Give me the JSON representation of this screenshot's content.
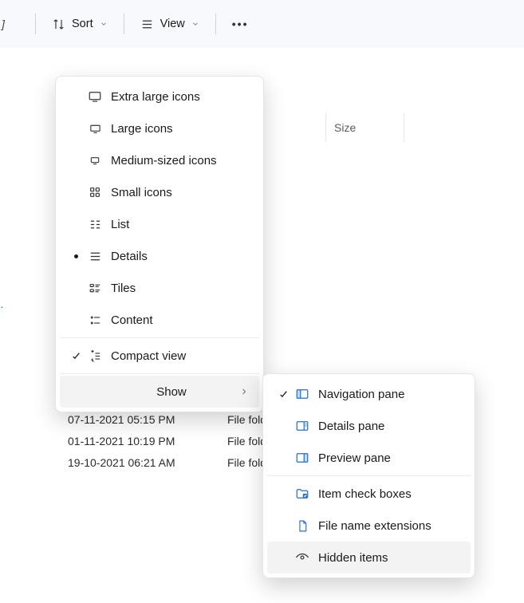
{
  "toolbar": {
    "sort_label": "Sort",
    "view_label": "View"
  },
  "columns": {
    "size": "Size"
  },
  "view_menu": {
    "items": [
      {
        "label": "Extra large icons"
      },
      {
        "label": "Large icons"
      },
      {
        "label": "Medium-sized icons"
      },
      {
        "label": "Small icons"
      },
      {
        "label": "List"
      },
      {
        "label": "Details",
        "selected": true
      },
      {
        "label": "Tiles"
      },
      {
        "label": "Content"
      }
    ],
    "compact": {
      "label": "Compact view",
      "checked": true
    },
    "show": {
      "label": "Show"
    }
  },
  "show_submenu": {
    "items": [
      {
        "label": "Navigation pane",
        "checked": true
      },
      {
        "label": "Details pane"
      },
      {
        "label": "Preview pane"
      },
      {
        "label": "Item check boxes"
      },
      {
        "label": "File name extensions"
      },
      {
        "label": "Hidden items",
        "hover": true
      }
    ]
  },
  "rows": [
    {
      "date": "07-11-2021 05:15 PM",
      "type": "File folde"
    },
    {
      "date": "01-11-2021 10:19 PM",
      "type": "File folde"
    },
    {
      "date": "19-10-2021 06:21 AM",
      "type": "File folde"
    }
  ]
}
